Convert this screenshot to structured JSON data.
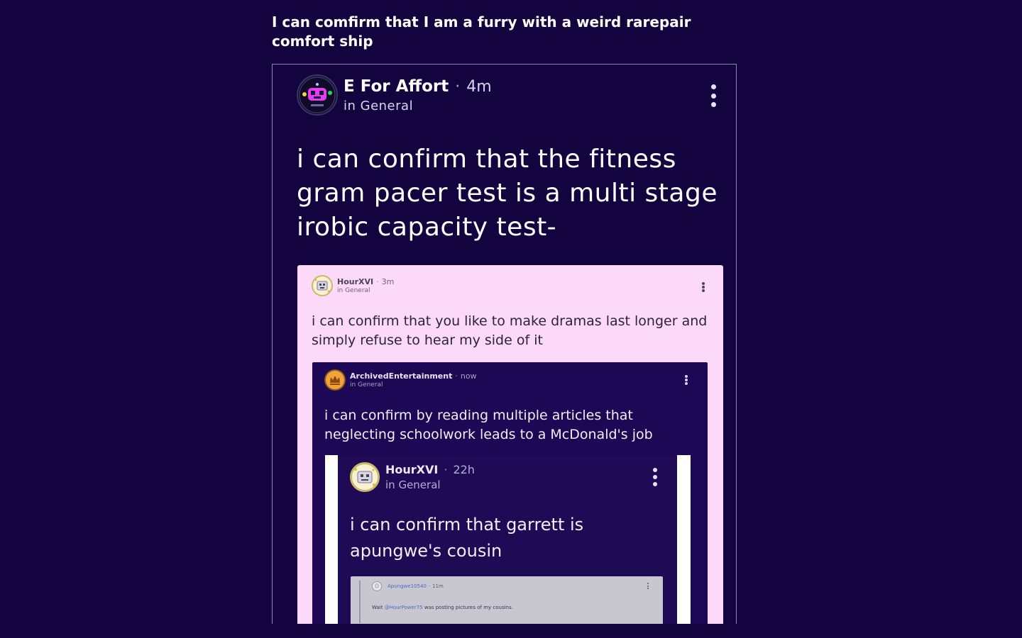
{
  "caption": "I can comfirm that I am a furry with a weird rarepair comfort ship",
  "post": {
    "author": "E For Affort",
    "separator": "·",
    "time": "4m",
    "location": "in General",
    "text": "i can confirm that the fitness gram pacer test is a multi stage irobic capacity test-",
    "quoted": {
      "author": "HourXVI",
      "separator": "·",
      "time": "3m",
      "location": "in General",
      "text": "i can confirm that you like to make dramas last longer and simply refuse to hear my side of it",
      "quoted": {
        "author": "ArchivedEntertainment",
        "separator": "·",
        "time": "now",
        "location": "in General",
        "text": "i can confirm by reading multiple articles that neglecting schoolwork leads to a McDonald's job",
        "quoted": {
          "author": "HourXVI",
          "separator": "·",
          "time": "22h",
          "location": "in General",
          "text": "i can confirm that garrett is apungwe's cousin",
          "quoted": {
            "author": "Apungwe10540",
            "separator": "·",
            "time": "11m",
            "text_prefix": "Wait ",
            "mention": "@HourPower75",
            "text_suffix": " was posting pictures of my cousins."
          }
        }
      }
    }
  },
  "colors": {
    "background": "#13043f",
    "pink_card": "#fcd8f9",
    "dark_card": "#1c0854",
    "grey_card": "#c8c6cf",
    "mention": "#4a6bc4"
  },
  "icons": {
    "post_avatar": "robot-avatar-icon",
    "quoted_avatar": "game-avatar-icon",
    "archived_avatar": "crown-avatar-icon",
    "menu": "more-vertical-icon"
  }
}
